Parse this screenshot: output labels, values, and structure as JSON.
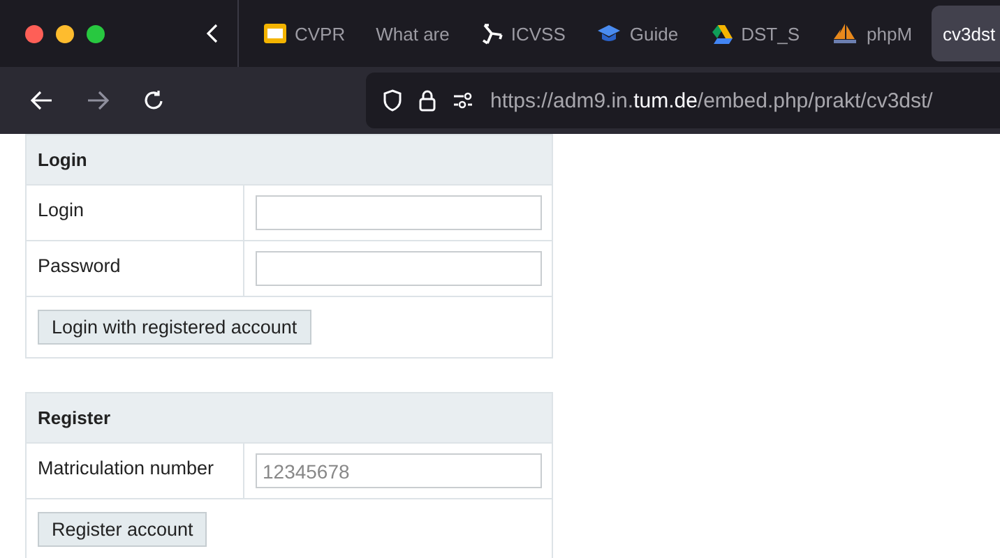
{
  "browser": {
    "tabs": [
      {
        "label": "CVPR",
        "kind": "slides",
        "selected": false
      },
      {
        "label": "What are",
        "kind": "plain",
        "selected": false
      },
      {
        "label": "ICVSS",
        "kind": "triskelion",
        "selected": false
      },
      {
        "label": "Guide",
        "kind": "cap",
        "selected": false
      },
      {
        "label": "DST_S",
        "kind": "drive",
        "selected": false
      },
      {
        "label": "phpM",
        "kind": "sailboat",
        "selected": false
      },
      {
        "label": "cv3dst",
        "kind": "plain",
        "selected": true
      }
    ],
    "forward_disabled": true,
    "url": "https://adm9.in.**tum.de**/embed.php/prakt/cv3dst/"
  },
  "forms": [
    {
      "title": "Login",
      "fields": [
        {
          "label": "Login"
        },
        {
          "label": "Password"
        }
      ],
      "button": "Login with registered account"
    },
    {
      "title": "Register",
      "fields": [
        {
          "label": "Matriculation number",
          "placeholder": "12345678"
        }
      ],
      "button": "Register account"
    }
  ]
}
